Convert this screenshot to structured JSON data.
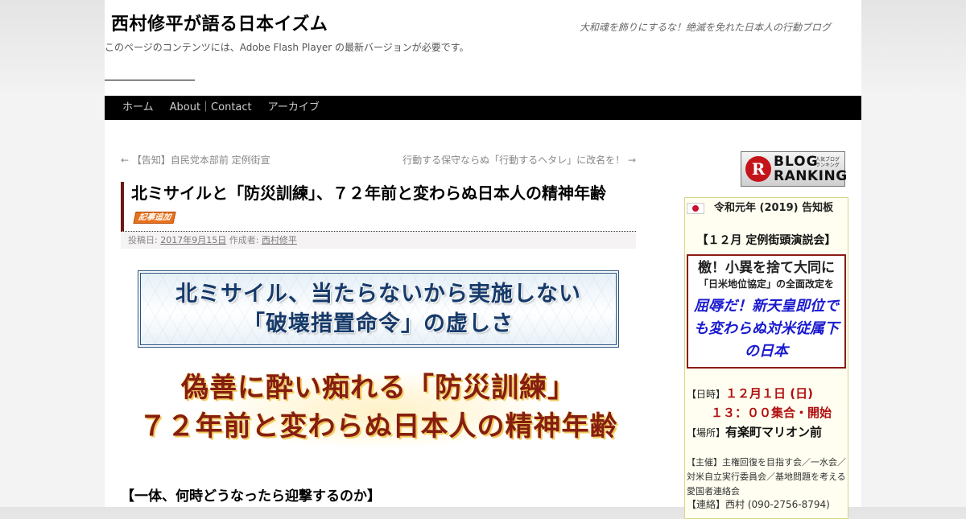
{
  "header": {
    "site_title": "西村修平が語る日本イズム",
    "site_description": "大和魂を飾りにするな！絶滅を免れた日本人の行動ブログ",
    "flash_notice": "このページのコンテンツには、Adobe Flash Player の最新バージョンが必要です。"
  },
  "nav": {
    "items": [
      "ホーム",
      "About｜Contact",
      "アーカイブ"
    ]
  },
  "post_nav": {
    "prev": "← 【告知】自民党本部前 定例街宣",
    "next": "行動する保守ならぬ「行動するヘタレ」に改名を！ →"
  },
  "entry": {
    "title": "北ミサイルと「防災訓練」、７２年前と変わらぬ日本人の精神年齢",
    "badge": "記事追加",
    "meta_posted_label": "投稿日: ",
    "meta_date": "2017年9月15日",
    "meta_author_label": " 作成者: ",
    "meta_author": "西村修平",
    "banner_line1": "北ミサイル、当たらないから実施しない",
    "banner_line2": "「破壊措置命令」の虚しさ",
    "headline_line1": "偽善に酔い痴れる「防災訓練」",
    "headline_line2": "７２年前と変わらぬ日本人の精神年齢",
    "section_heading": "【一体、何時どうなったら迎撃するのか】"
  },
  "sidebar": {
    "ranking_banner": {
      "letter": "R",
      "word1": "BLOG",
      "word2": "RANKING",
      "small_line1": "人気ブログ",
      "small_line2": "ランキング"
    },
    "notice": {
      "title": "令和元年 (2019) 告知板",
      "event": "【１２月 定例街頭演説会】",
      "box_line1": "檄！小異を捨て大同に",
      "box_line2": "「日米地位協定」の全面改定を",
      "box_line3": "屈辱だ！新天皇即位でも変わらぬ対米従属下の日本",
      "date_label": "【日時】",
      "date_value": "１２月１日 (日)",
      "time_value": "１３：００集合・開始",
      "place_label": "【場所】",
      "place_value": "有楽町マリオン前",
      "organizer": "【主催】主権回復を目指す会／一水会／対米自立実行委員会／基地問題を考える愛国者連絡会",
      "contact": "【連絡】西村 (090-2756-8794)"
    }
  }
}
